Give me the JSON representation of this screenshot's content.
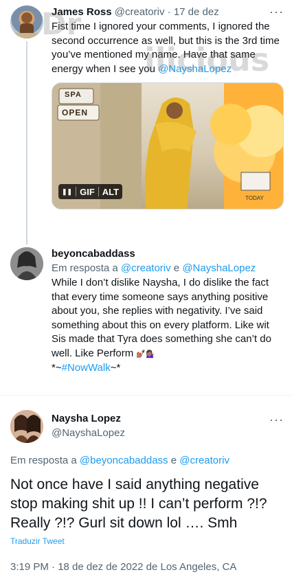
{
  "tweet1": {
    "name": "James Ross",
    "handle": "@creatoriv",
    "dot": "·",
    "date": "17 de dez",
    "more": "···",
    "text_before": "Fist time I ignored your comments, I ignored the second occurrence as well, but this is the 3rd time you’ve mentioned my name. Have that same energy when I see you ",
    "mention": "@NayshaLopez",
    "media": {
      "pause": "❚❚",
      "gif": "GIF",
      "alt": "ALT",
      "sign_spa": "SPA",
      "sign_open": "OPEN",
      "sign_today": "TODAY"
    }
  },
  "watermark": {
    "line1": "Dr",
    "line2": "ilicious"
  },
  "tweet2": {
    "name": "beyoncabaddass",
    "reply_prefix": "Em resposta a ",
    "reply_mention1": "@creatoriv",
    "reply_and": " e ",
    "reply_mention2": "@NayshaLopez",
    "text": "While I don’t dislike Naysha, I do dislike the fact that every time someone says anything positive about you, she replies with negativity. I’ve said something about this on every platform. Like wit Sis made that Tyra does something she can’t do well. Like Perform ",
    "emoji": "💅🏽💁🏽‍♀️",
    "hashtag_prefix": "*~",
    "hashtag": "#NowWalk",
    "hashtag_suffix": "~*"
  },
  "tweet3": {
    "name": "Naysha Lopez",
    "handle": "@NayshaLopez",
    "more": "···",
    "reply_prefix": "Em resposta a ",
    "reply_mention1": "@beyoncabaddass",
    "reply_and": " e ",
    "reply_mention2": "@creatoriv",
    "text": "Not once have I said anything negative stop making shit up !! I can’t perform ?!? Really ?!? Gurl sit down lol …. Smh",
    "translate": "Traduzir Tweet",
    "timestamp": "3:19 PM · 18 de dez de 2022 de Los Angeles, CA"
  },
  "colors": {
    "link": "#1d9bf0",
    "muted": "#536471",
    "text": "#0f1419",
    "thread": "#cfd9de"
  }
}
